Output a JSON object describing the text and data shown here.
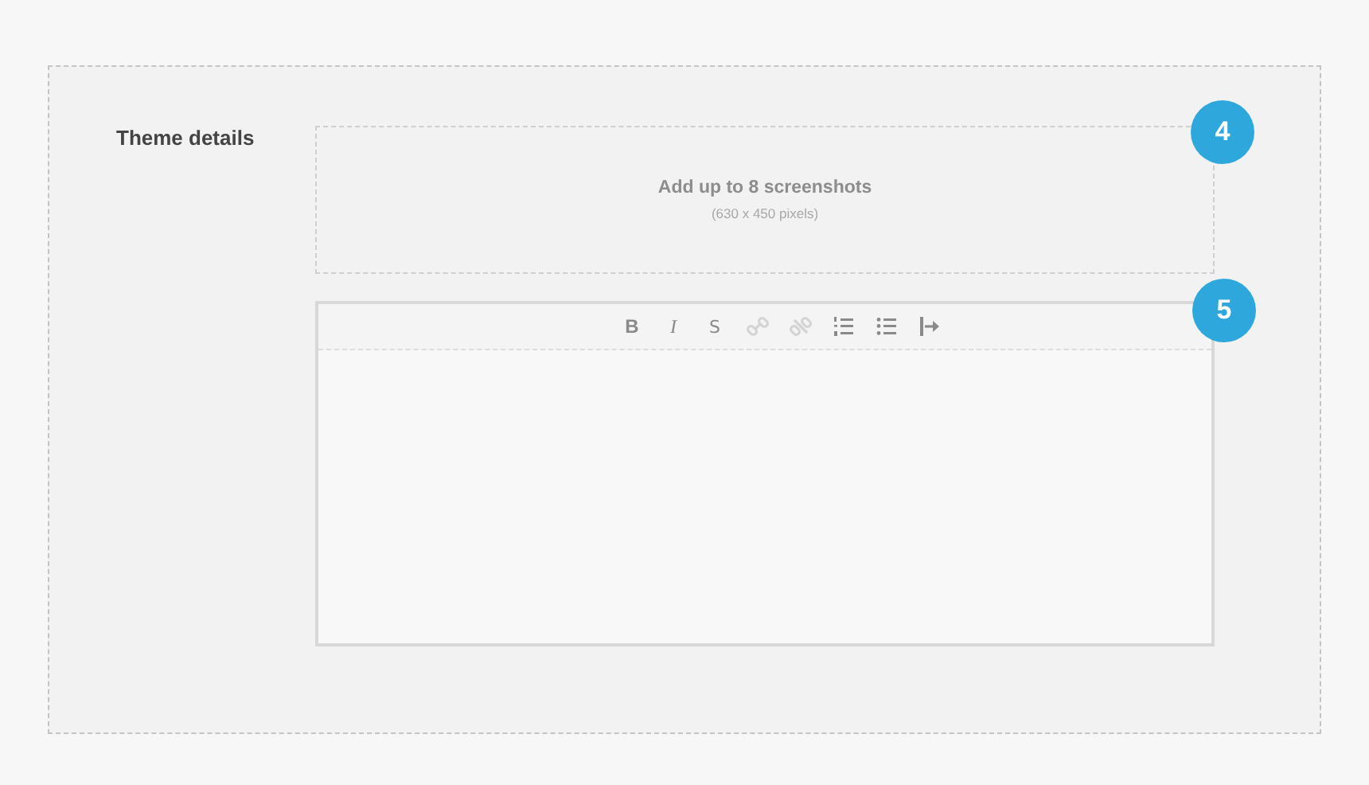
{
  "section_label": "Theme details",
  "screenshot_upload": {
    "title": "Add up to 8 screenshots",
    "hint": "(630 x 450 pixels)",
    "step": "4"
  },
  "editor": {
    "step": "5",
    "toolbar": [
      {
        "kind": "bold",
        "label": "B",
        "disabled": false
      },
      {
        "kind": "italic",
        "label": "I",
        "disabled": false
      },
      {
        "kind": "strike",
        "label": "S",
        "disabled": false
      },
      {
        "kind": "link",
        "disabled": true
      },
      {
        "kind": "unlink",
        "disabled": true
      },
      {
        "kind": "ordered-list",
        "disabled": false
      },
      {
        "kind": "bullet-list",
        "disabled": false
      },
      {
        "kind": "indent",
        "disabled": false
      }
    ]
  }
}
